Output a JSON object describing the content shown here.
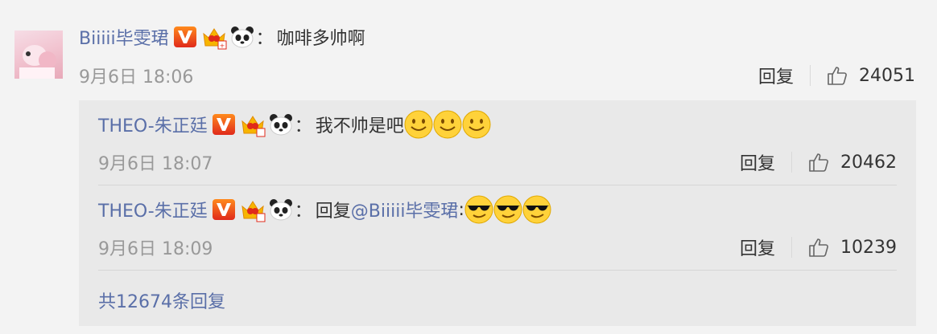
{
  "comment": {
    "user": "Biiiii毕雯珺",
    "text": "咖啡多帅啊",
    "time": "9月6日 18:06",
    "reply_label": "回复",
    "likes": "24051"
  },
  "colon": "：",
  "replies": [
    {
      "user": "THEO-朱正廷",
      "text": "我不帅是吧",
      "emoji": "smile",
      "time": "9月6日 18:07",
      "reply_label": "回复",
      "likes": "20462"
    },
    {
      "user": "THEO-朱正廷",
      "prefix": "回复",
      "mention": "@Biiiii毕雯珺",
      "mention_colon": ":",
      "emoji": "sunglasses",
      "time": "9月6日 18:09",
      "reply_label": "回复",
      "likes": "10239"
    }
  ],
  "total_replies": "共12674条回复",
  "colors": {
    "link": "#5a6fa8",
    "text": "#333333",
    "meta": "#999999",
    "background": "#f3f3f3",
    "reply_background": "#e9e9e9",
    "verified_badge": "#e02a1b"
  },
  "icons": [
    "verified-v-icon",
    "vip-crown-icon",
    "panda-icon",
    "smile-emoji-icon",
    "sunglasses-emoji-icon",
    "thumbs-up-icon"
  ]
}
